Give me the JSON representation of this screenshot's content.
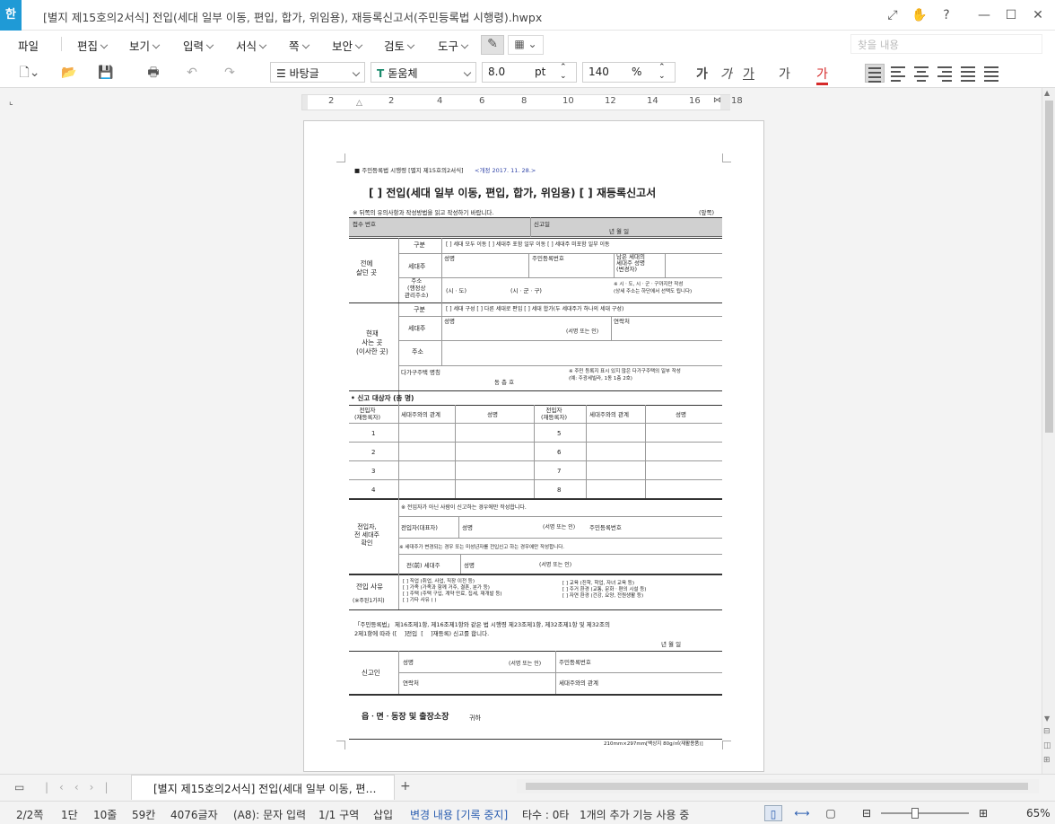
{
  "window": {
    "title": "[별지 제15호의2서식] 전입(세대 일부 이동, 편입, 합가, 위임용), 재등록신고서(주민등록법 시행령).hwpx",
    "logo": "한"
  },
  "menu": {
    "items": [
      "파일",
      "편집",
      "보기",
      "입력",
      "서식",
      "쪽",
      "보안",
      "검토",
      "도구"
    ],
    "search_placeholder": "찾을 내용"
  },
  "toolbar": {
    "style": "바탕글",
    "font": "돋움체",
    "size": "8.0",
    "size_unit": "pt",
    "zoom": "140",
    "zoom_unit": "%",
    "fmt": [
      "가",
      "가",
      "가",
      "가",
      "가"
    ],
    "text_color": "#d62a2a"
  },
  "ruler": {
    "marks": [
      "2",
      "2",
      "4",
      "6",
      "8",
      "10",
      "12",
      "14",
      "16",
      "18"
    ]
  },
  "form": {
    "header": "■ 주민등록법 시행령 [별지 제15호의2서식]",
    "amend": "<개정 2017. 11. 28.>",
    "title": "[   ] 전입(세대 일부 이동, 편입, 합가, 위임용) [   ] 재등록신고서",
    "notice": "※  뒤쪽의 유의사항과 작성방법을 읽고 작성하기 바랍니다.",
    "front": "(앞쪽)",
    "receipt_no": "접수 번호",
    "report_date": "신고일",
    "ymd": "년          월          일",
    "prev_place": "전에\n살던 곳",
    "gubun": "구분",
    "prev_gubun": "[  ] 세대 모두 이동  [  ] 세대주 포함 일부 이동  [  ] 세대주 미포함 일부 이동",
    "householder": "세대주",
    "name": "성명",
    "rrn": "주민등록번호",
    "remain_head": "남은 세대의\n세대주 성명\n(변경자)",
    "addr_label": "주소\n(행정상\n관리주소)",
    "addr_si": "(시ㆍ도)",
    "addr_sgg": "(시ㆍ군ㆍ구)",
    "addr_note": "※ 시ㆍ도, 시ㆍ군ㆍ구까지만 작성\n(상세 주소는 하단에서 선택도 됩니다)",
    "cur_place": "현재\n사는 곳\n(이사한 곳)",
    "cur_gubun": "[  ] 세대 구성  [  ] 다른 세대로 편입   [  ] 세대 합가(두 세대주가 하나의 세대 구성)",
    "sign": "(서명 또는 인)",
    "contact": "연락처",
    "addr": "주소",
    "multi": "다가구주택 명칭",
    "multi_note": "※ 주민 등록지 표시 있지 않은 다가구주택의 일부 작성\n(예: 주광세빌라, 1동 1층 2호)",
    "dong_ho": "동          층          호",
    "target": "• 신고 대상자 (총        명)",
    "cols": [
      "전입자\n(재등록자)",
      "세대주와의 관계",
      "성명"
    ],
    "rows_left": [
      "1",
      "2",
      "3",
      "4"
    ],
    "rows_right": [
      "5",
      "6",
      "7",
      "8"
    ],
    "confirm": "전입자,\n전 세대주\n확인",
    "confirm_note1": "※ 전입자가 아닌 사람이 신고하는 경우에만 작성합니다.",
    "rep": "전입자(대표자)",
    "confirm_note2": "※ 세대주가 변경되는 경우 또는 미성년자를 전입신고 하는 경우에만 작성합니다.",
    "prev_head": "전(前) 세대주",
    "reason": "전입 사유",
    "reason_sub": "(※주된1가지)",
    "reasons_l": [
      "[  ] 직업 (취업, 사업, 직장 이전 등)",
      "[  ] 가족 (가족과 함께 거주, 결혼, 분가 등)",
      "[  ] 주택 (주택 구입, 계약 만료, 집세, 재개발 등)",
      "[  ] 기타 사유 (       )"
    ],
    "reasons_r": [
      "[  ] 교육 (진학, 학업, 자녀 교육 등)",
      "[  ] 주거 환경 (교통, 문화ㆍ편의 시설 등)",
      "[  ] 자연 환경 (건강, 요양, 전원생활 등)"
    ],
    "law": "「주민등록법」 제16조제1항, 제16조제1항와 같은 법 시행령 제23조제1항, 제32조제1항 및 제32조의\n2제1항에 따라 ([    ]전입  [    ]재등록) 신고를 합니다.",
    "declarant": "신고인",
    "relation": "세대주와의 관계",
    "to": "읍ㆍ면ㆍ동장 및 출장소장",
    "to_suffix": "귀하",
    "paper": "210mm×297mm[백상지 80g/㎡(재활용품)]"
  },
  "tab": {
    "label": "[별지 제15호의2서식] 전입(세대 일부 이동, 편…"
  },
  "status": {
    "page": "2/2쪽",
    "col": "1단",
    "line": "10줄",
    "chars": "59칸",
    "count": "4076글자",
    "mode": "(A8): 문자 입력",
    "section": "1/1 구역",
    "insert": "삽입",
    "track": "변경 내용 [기록 중지]",
    "typing": "타수 : 0타",
    "addon": "1개의 추가 기능 사용 중",
    "zoom": "65%"
  }
}
